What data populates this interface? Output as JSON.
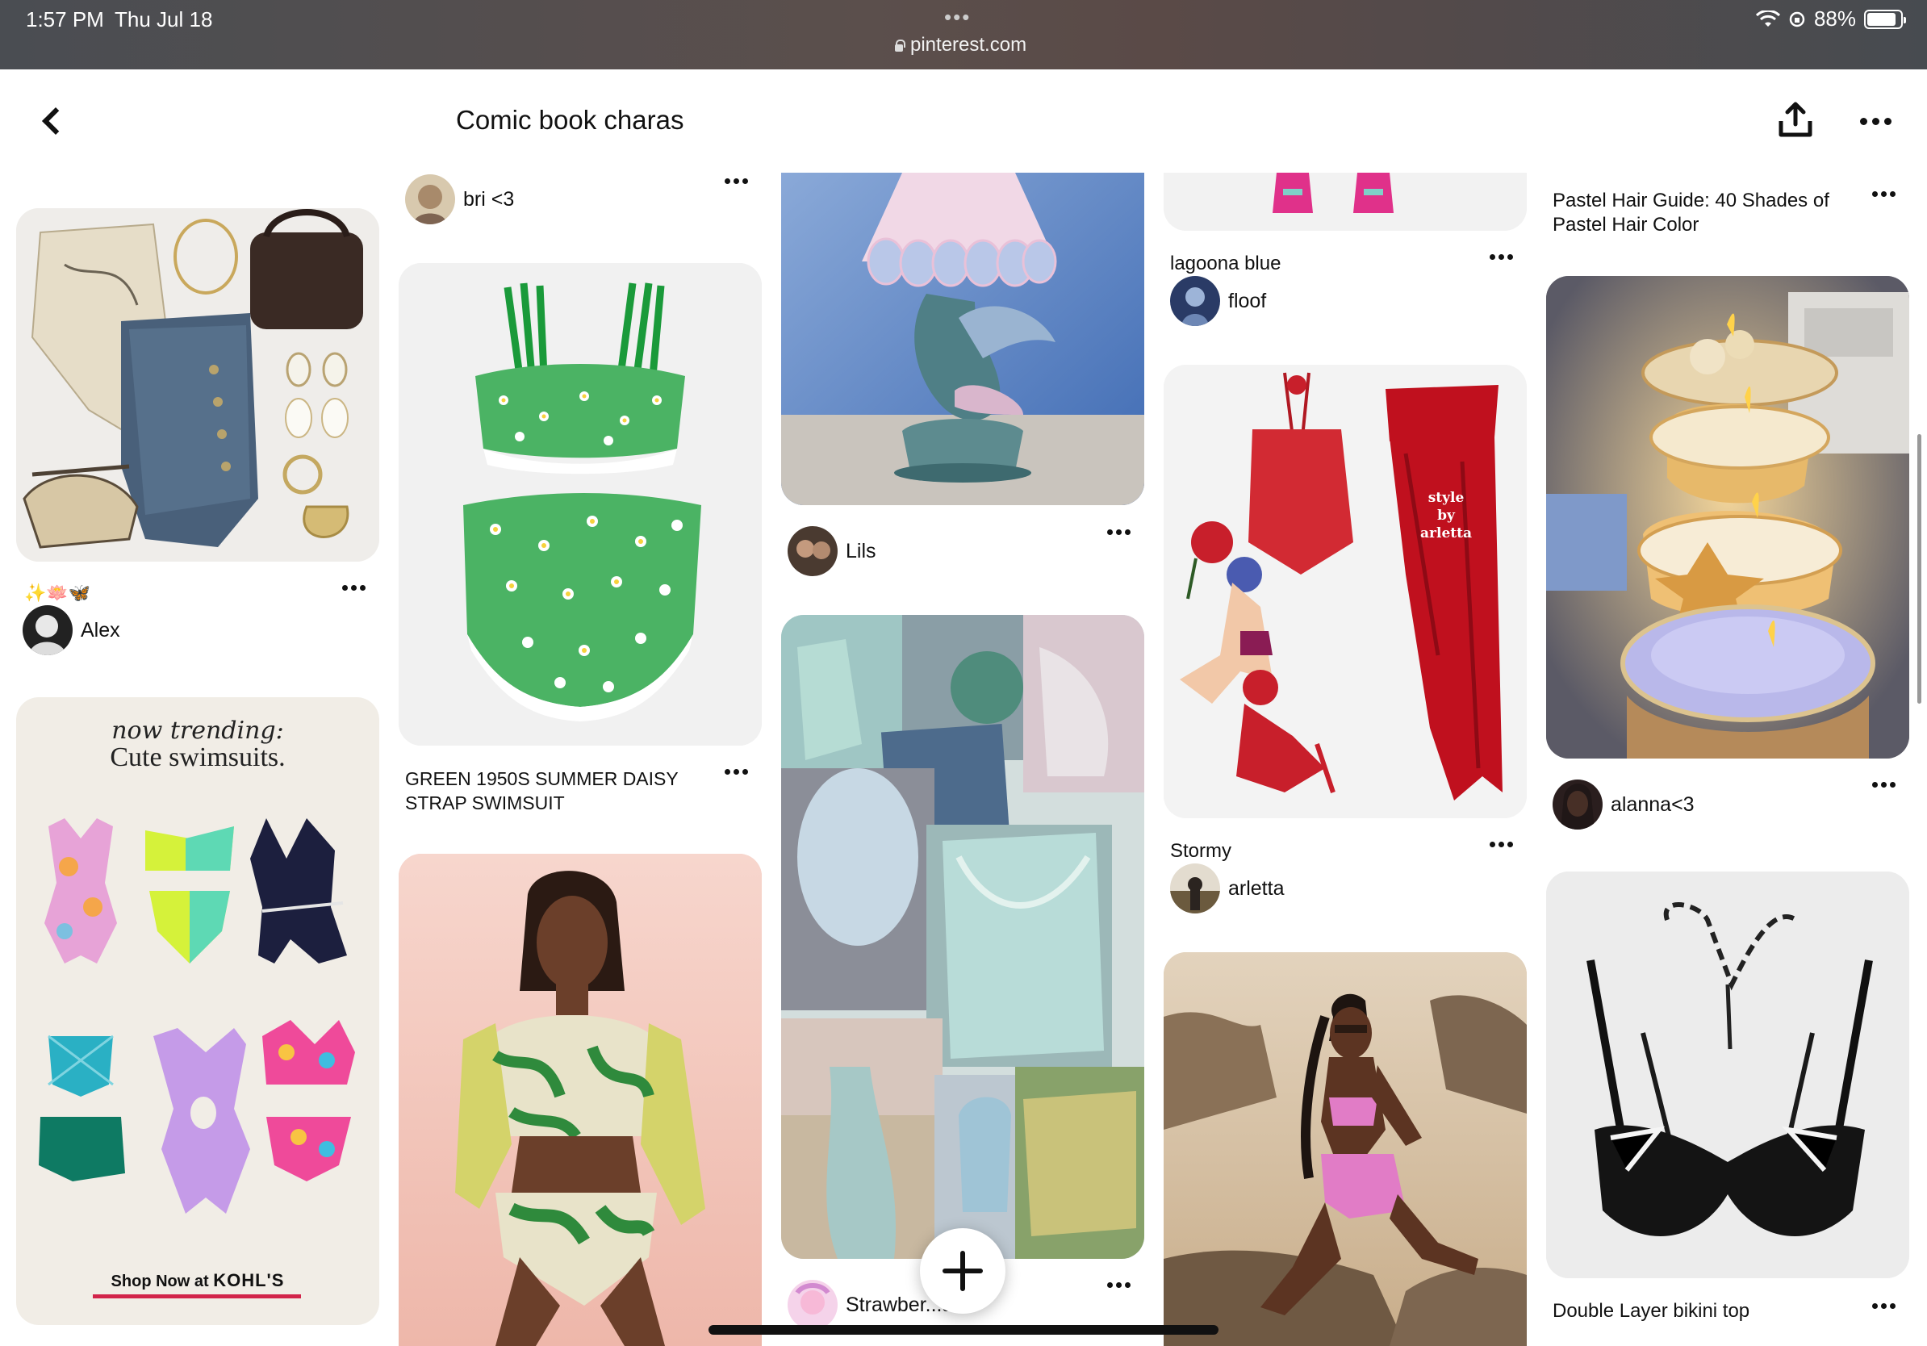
{
  "status_bar": {
    "time": "1:57 PM",
    "date": "Thu Jul 18",
    "url": "pinterest.com",
    "battery": "88%",
    "battery_level": 0.88
  },
  "header": {
    "title": "Comic book charas",
    "back_icon": "chevron-left-icon",
    "share_icon": "share-icon",
    "more_icon": "more-icon"
  },
  "pins": {
    "alex_emoji": "✨🪷🦋",
    "alex_creator": "Alex",
    "ad_headline": "now trending:",
    "ad_subhead": "Cute swimsuits.",
    "ad_cta_prefix": "Shop Now at",
    "ad_brand": "KOHL'S",
    "bri_creator": "bri <3",
    "swimsuit_title": "GREEN 1950S SUMMER DAISY STRAP SWIMSUIT",
    "lils_creator": "Lils",
    "straw_creator": "Strawber...a",
    "lagoona_title": "lagoona blue",
    "floof_creator": "floof",
    "stormy_title": "Stormy",
    "arletta_creator": "arletta",
    "arletta_watermark": "style by arletta",
    "pastel_title": "Pastel Hair Guide: 40 Shades of Pastel Hair Color",
    "alanna_creator": "alanna<3",
    "bikini_title": "Double Layer bikini top"
  },
  "fab": {
    "icon": "plus-icon"
  }
}
